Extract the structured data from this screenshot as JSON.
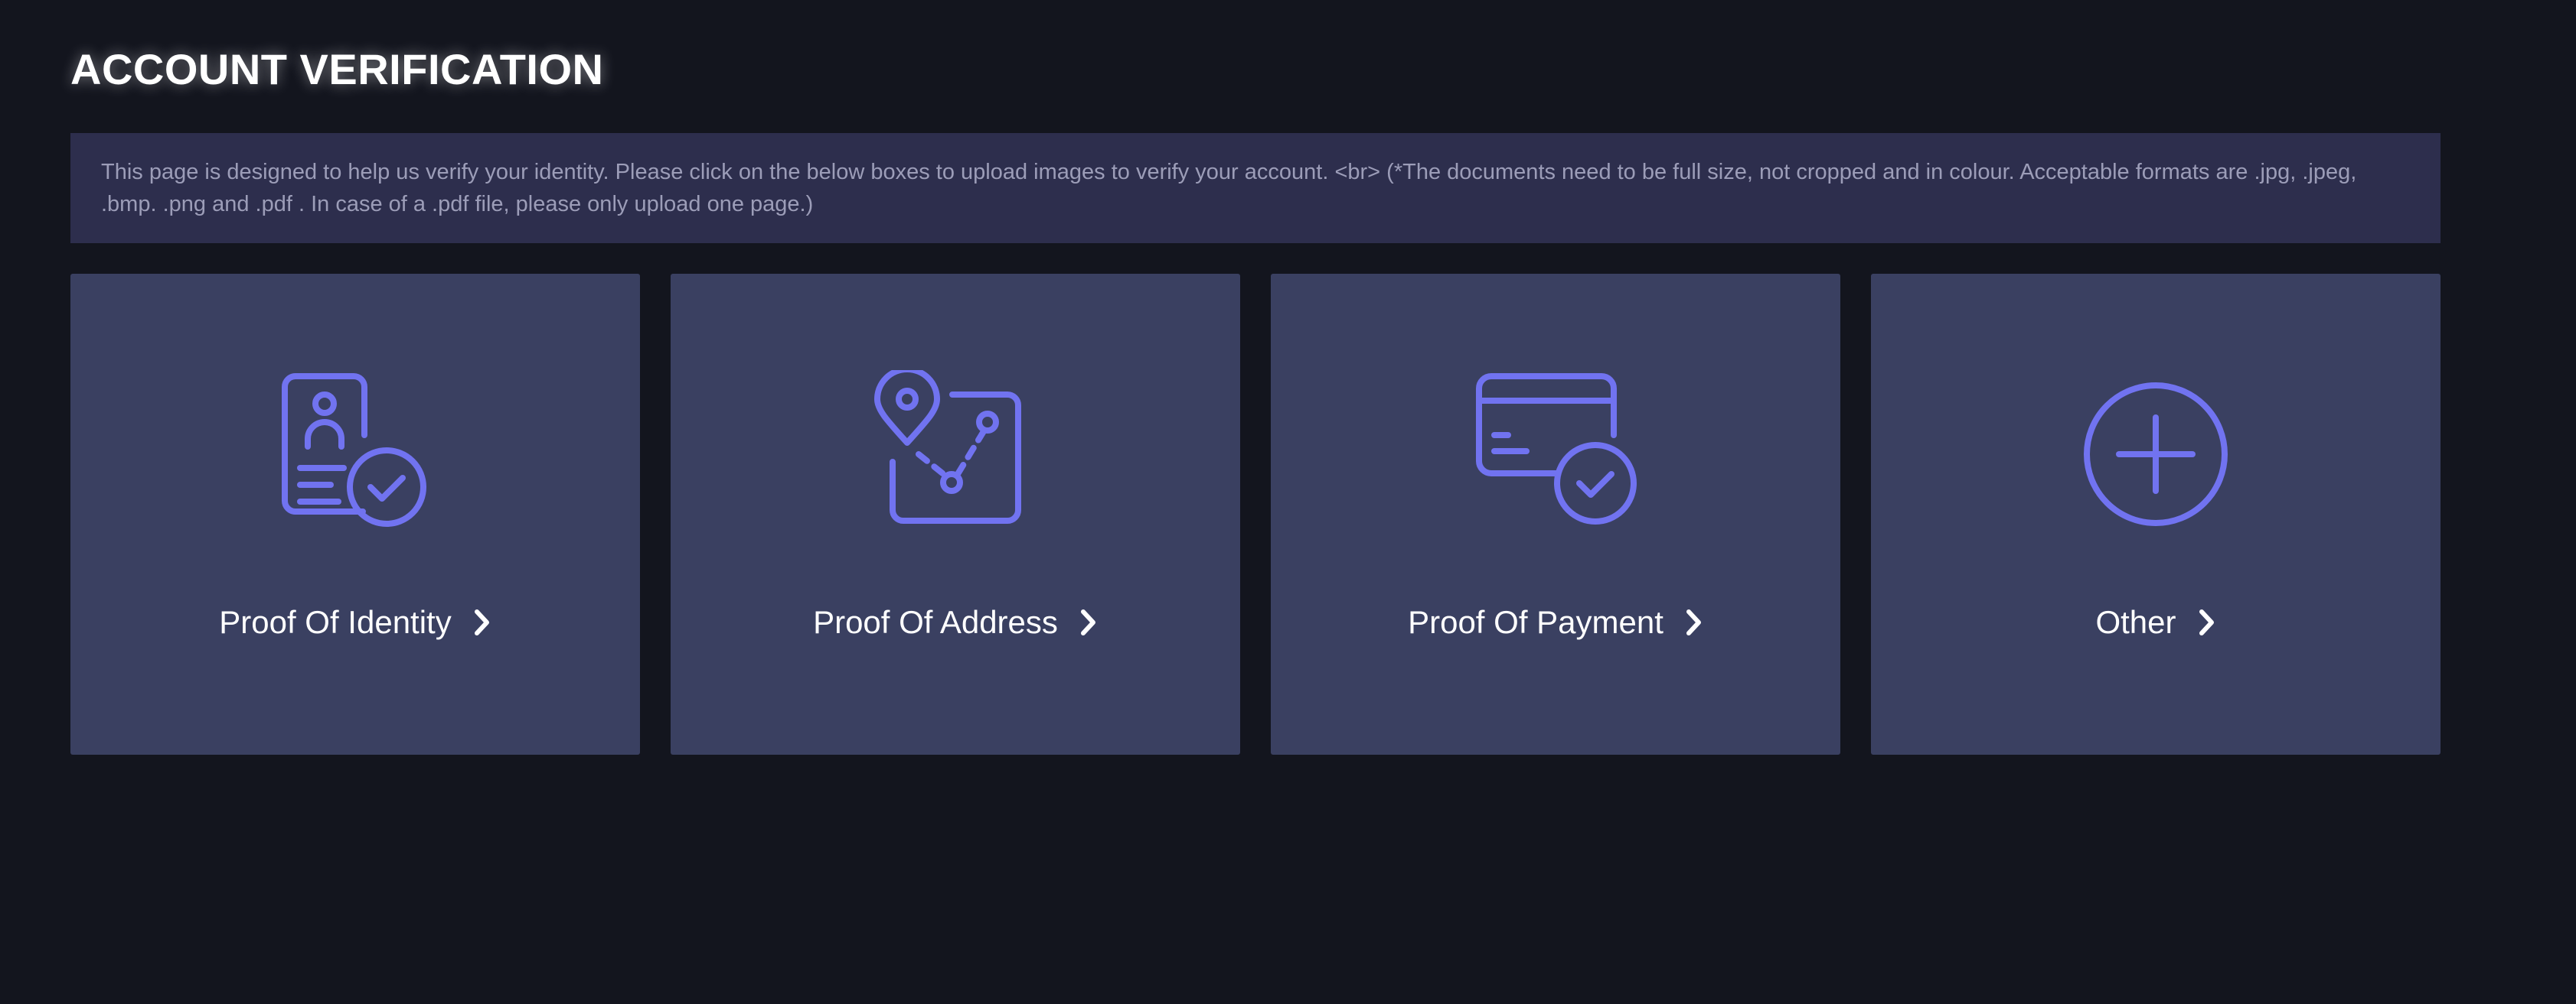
{
  "page": {
    "title": "ACCOUNT VERIFICATION",
    "info": "This page is designed to help us verify your identity. Please click on the below boxes to upload images to verify your account. <br> (*The documents need to be full size, not cropped and in colour. Acceptable formats are .jpg, .jpeg, .bmp. .png and .pdf . In case of a .pdf file, please only upload one page.)"
  },
  "cards": [
    {
      "label": "Proof Of Identity",
      "icon": "id-card-check-icon"
    },
    {
      "label": "Proof Of Address",
      "icon": "map-pin-route-icon"
    },
    {
      "label": "Proof Of Payment",
      "icon": "credit-card-check-icon"
    },
    {
      "label": "Other",
      "icon": "plus-circle-icon"
    }
  ],
  "colors": {
    "background": "#13151e",
    "info_box": "#2d2e4d",
    "card": "#3a4061",
    "icon_accent": "#7173f0",
    "label": "#ffffff"
  }
}
